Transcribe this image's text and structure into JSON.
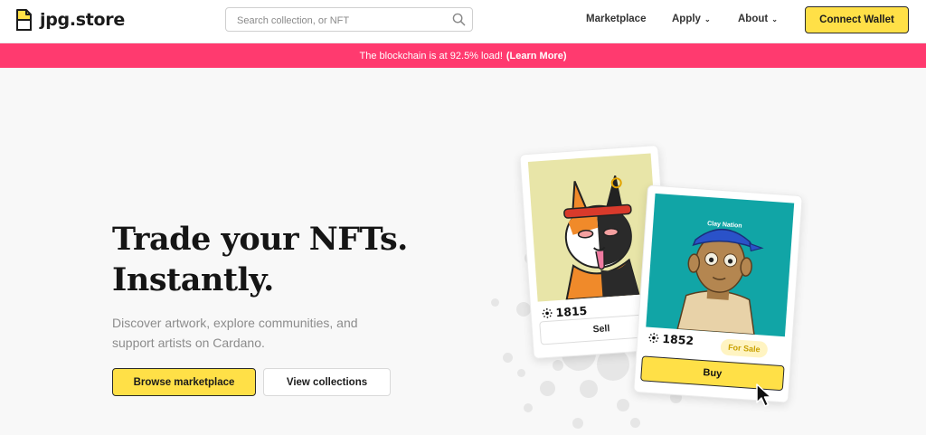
{
  "header": {
    "logo_text": "jpg.store",
    "search_placeholder": "Search collection, or NFT",
    "nav": {
      "marketplace": "Marketplace",
      "apply": "Apply",
      "about": "About"
    },
    "connect_wallet": "Connect Wallet"
  },
  "banner": {
    "text": "The blockchain is at 92.5% load!",
    "link": "(Learn More)"
  },
  "hero": {
    "title_line1": "Trade your NFTs.",
    "title_line2": "Instantly.",
    "subtitle": "Discover artwork, explore communities, and support artists on Cardano.",
    "browse_button": "Browse marketplace",
    "view_button": "View collections"
  },
  "cards": {
    "card1": {
      "price": "1815",
      "action": "Sell"
    },
    "card2": {
      "price": "1852",
      "badge": "For Sale",
      "action": "Buy",
      "cap_text": "Clay Nation"
    }
  },
  "colors": {
    "accent_yellow": "#ffe047",
    "banner_pink": "#ff3a6f",
    "teal": "#11a5a6"
  }
}
